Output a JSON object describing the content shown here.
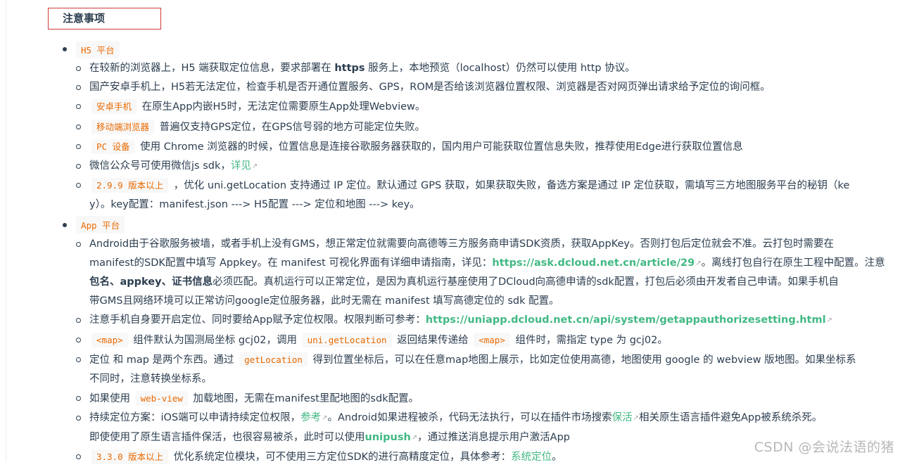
{
  "section_title": "注意事项",
  "h5": {
    "tag": "H5 平台",
    "items": {
      "https": {
        "pre": "在较新的浏览器上，H5 端获取定位信息，要求部署在 ",
        "bold": "https",
        "post": " 服务上，本地预览（localhost）仍然可以使用 http 协议。"
      },
      "domestic": {
        "text": "国产安卓手机上，H5若无法定位，检查手机是否开通位置服务、GPS，ROM是否给该浏览器位置权限、浏览器是否对网页弹出请求给予定位的询问框。"
      },
      "android": {
        "tag": "安卓手机",
        "text": " 在原生App内嵌H5时，无法定位需要原生App处理Webview。"
      },
      "mobile": {
        "tag": "移动端浏览器",
        "text": " 普遍仅支持GPS定位，在GPS信号弱的地方可能定位失败。"
      },
      "pc": {
        "tag": "PC 设备",
        "text": " 使用 Chrome 浏览器的时候，位置信息是连接谷歌服务器获取的，国内用户可能获取位置信息失败，推荐使用Edge进行获取位置信息"
      },
      "wechat": {
        "text": "微信公众号可使用微信js sdk，",
        "link": "详见"
      },
      "v299": {
        "tag": "2.9.9 版本以上",
        "line1": " ，优化 uni.getLocation 支持通过 IP 定位。默认通过 GPS 获取，如果获取失败，备选方案是通过 IP 定位获取，需填写三方地图服务平台的秘钥（ke",
        "line2": "y）。key配置：manifest.json ---> H5配置 ---> 定位和地图 ---> key。"
      }
    }
  },
  "app": {
    "tag": "App 平台",
    "items": {
      "gms": {
        "line1": "Android由于谷歌服务被墙，或者手机上没有GMS，想正常定位就需要向高德等三方服务商申请SDK资质，获取AppKey。否则打包后定位就会不准。云打包时需要在",
        "line2_pre": "manifest的SDK配置中填写 Appkey。在 manifest 可视化界面有详细申请指南，详见：",
        "line2_link": "https://ask.dcloud.net.cn/article/29",
        "line2_post": "。离线打包自行在原生工程中配置。注意",
        "line3_bold": "包名、appkey、证书信息",
        "line3_post": "必须匹配。真机运行可以正常定位，是因为真机运行基座使用了DCloud向高德申请的sdk配置，打包后必须由开发者自己申请。如果手机自",
        "line4": "带GMS且网络环境可以正常访问google定位服务器，此时无需在 manifest 填写高德定位的 sdk 配置。"
      },
      "permission": {
        "text": "注意手机自身要开启定位、同时要给App赋予定位权限。权限判断可参考：",
        "link": "https://uniapp.dcloud.net.cn/api/system/getappauthorizesetting.html"
      },
      "coords": {
        "tag1": "<map>",
        "t1": " 组件默认为国测局坐标 gcj02，调用 ",
        "tag2": "uni.getLocation",
        "t2": " 返回结果传递给 ",
        "tag3": "<map>",
        "t3": " 组件时，需指定 type 为 gcj02。"
      },
      "two_things": {
        "pre": "定位 和 map 是两个东西。通过 ",
        "tag": "getLocation",
        "line1_post": " 得到位置坐标后，可以在任意map地图上展示，比如定位使用高德，地图使用 google 的 webview 版地图。如果坐标系",
        "line2": "不同时，注意转换坐标系。"
      },
      "webview": {
        "pre": "如果使用 ",
        "tag": "web-view",
        "post": " 加载地图，无需在manifest里配地图的sdk配置。"
      },
      "continuous": {
        "pre": "持续定位方案：iOS端可以申请持续定位权限，",
        "link1": "参考",
        "mid": "。Android如果进程被杀，代码无法执行，可以在插件市场搜索",
        "link2": "保活",
        "post": "相关原生语言插件避免App被系统杀死。",
        "line2_pre": "即使使用了原生语言插件保活，也很容易被杀，此时可以使用",
        "line2_link": "unipush",
        "line2_post": "，通过推送消息提示用户激活App"
      },
      "v330": {
        "tag": "3.3.0 版本以上",
        "text": " 优化系统定位模块，可不使用三方定位SDK的进行高精度定位，具体参考：",
        "link": "系统定位",
        "post": "。"
      }
    }
  },
  "watermark": "CSDN @会说法语的猪",
  "icons": {
    "external_link": "external-link-icon"
  }
}
